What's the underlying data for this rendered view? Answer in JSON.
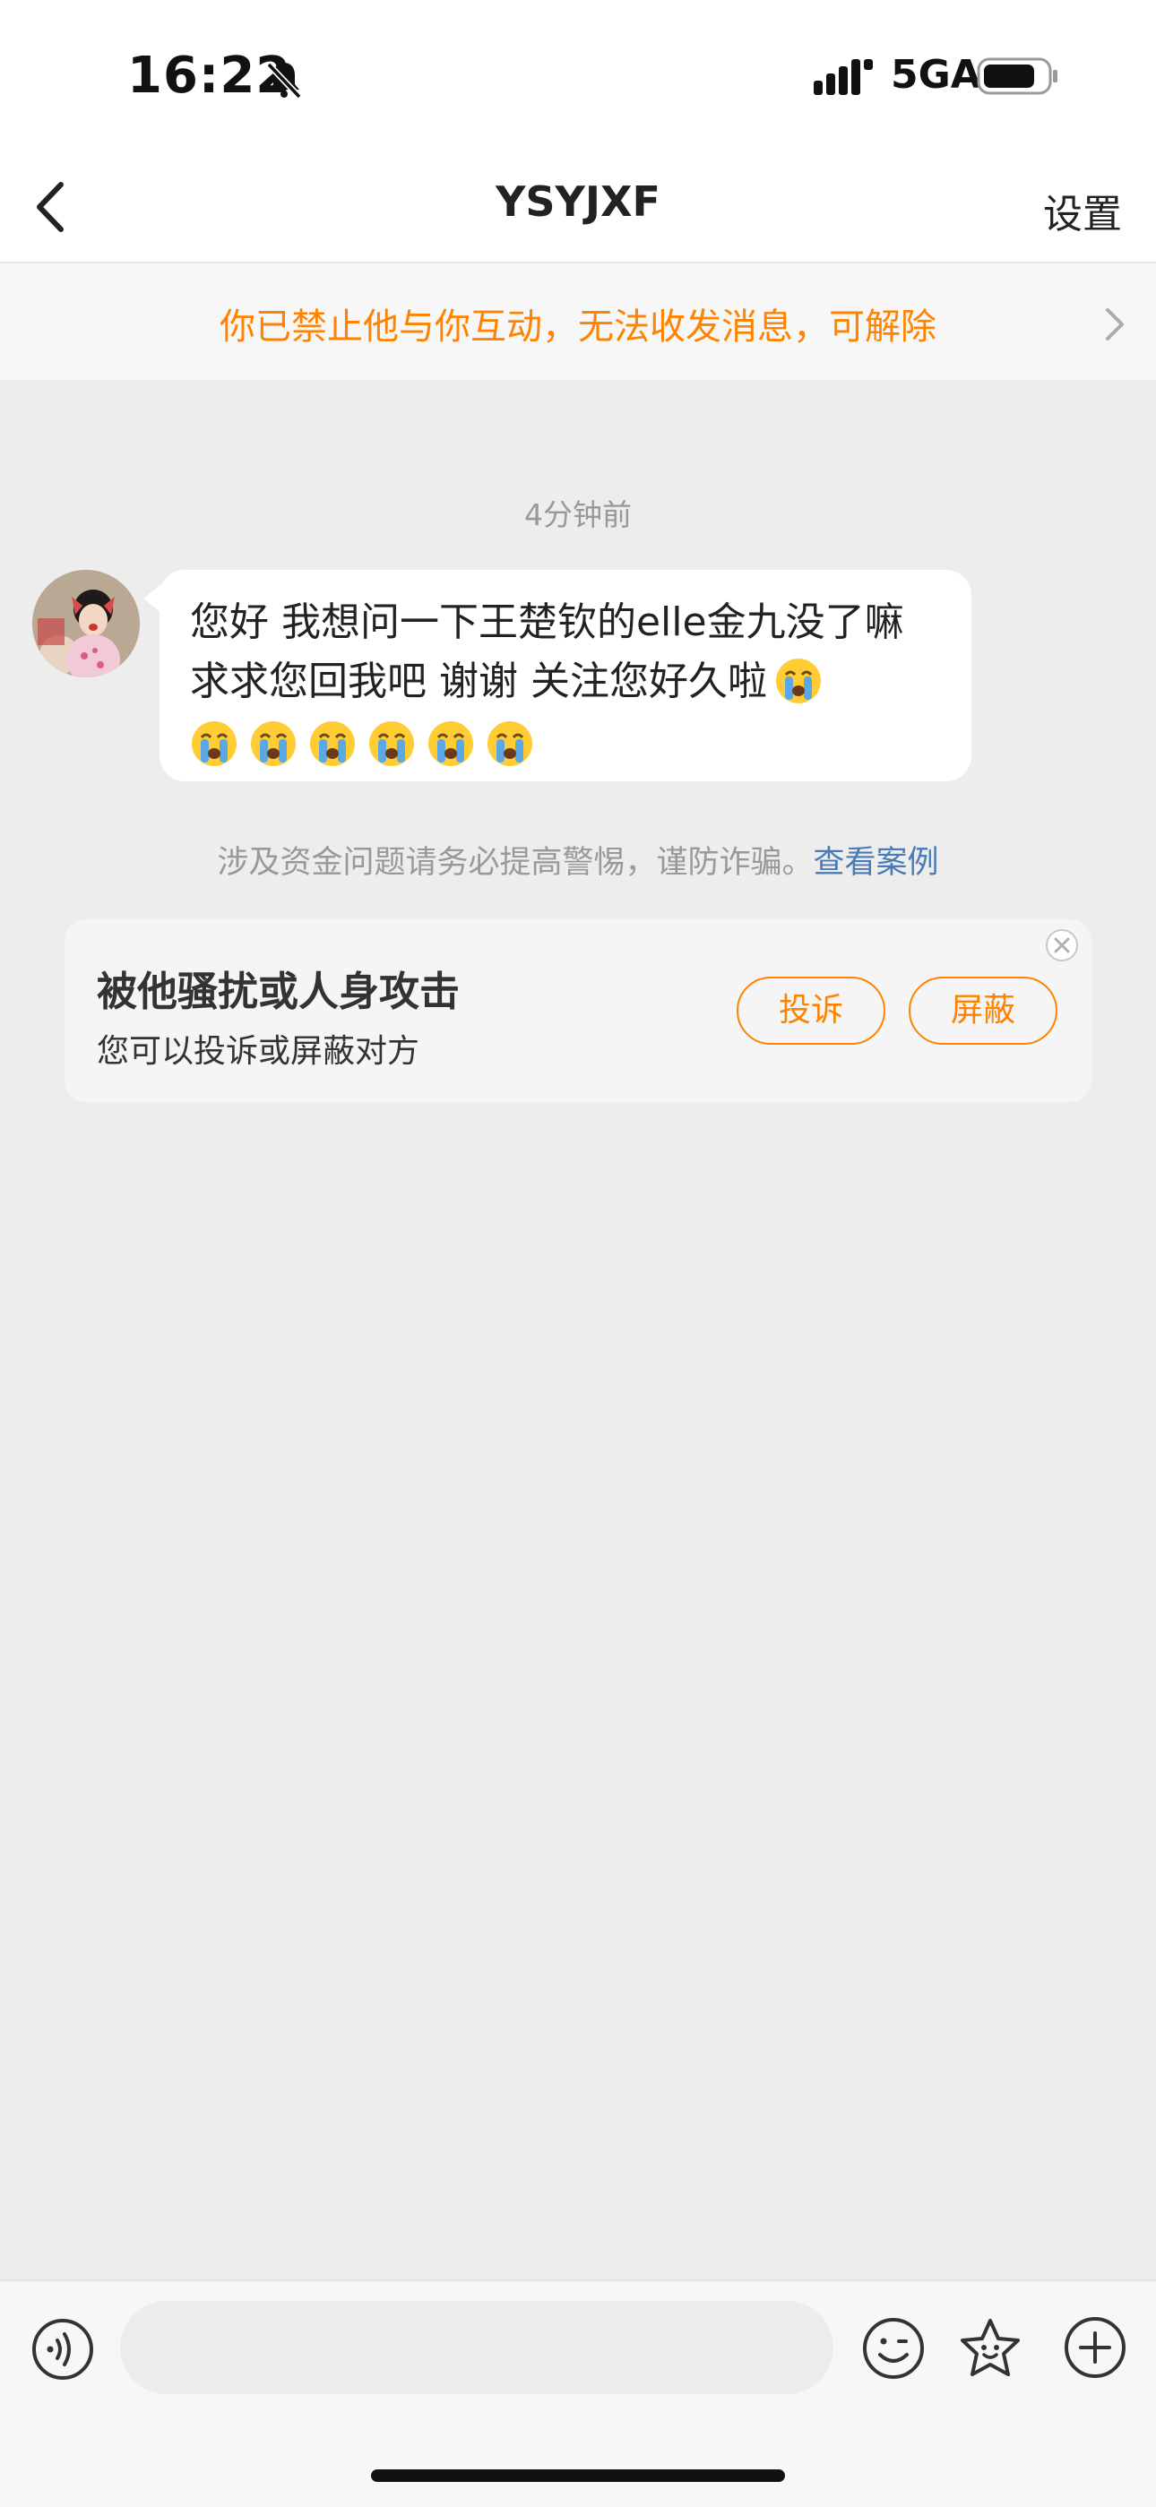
{
  "status_bar": {
    "time": "16:22",
    "network": "5GA"
  },
  "header": {
    "back_icon": "chevron-left-icon",
    "title": "YSYJXF",
    "settings_label": "设置"
  },
  "banner": {
    "text": "你已禁止他与你互动，无法收发消息，可解除",
    "chevron_icon": "chevron-right-icon"
  },
  "chat": {
    "timestamp": "4分钟前",
    "message": {
      "text": "您好 我想问一下王楚钦的elle金九没了嘛 求求您回我吧 谢谢 关注您好久啦",
      "emoji": "loudly-crying-face"
    }
  },
  "warning": {
    "text": "涉及资金问题请务必提高警惕，谨防诈骗。",
    "link_label": "查看案例"
  },
  "harass_card": {
    "title": "被他骚扰或人身攻击",
    "subtitle": "您可以投诉或屏蔽对方",
    "report_label": "投诉",
    "block_label": "屏蔽"
  },
  "input_bar": {
    "placeholder": ""
  },
  "colors": {
    "accent": "#ff8200",
    "link": "#4a7bb7",
    "background": "#ededed"
  }
}
